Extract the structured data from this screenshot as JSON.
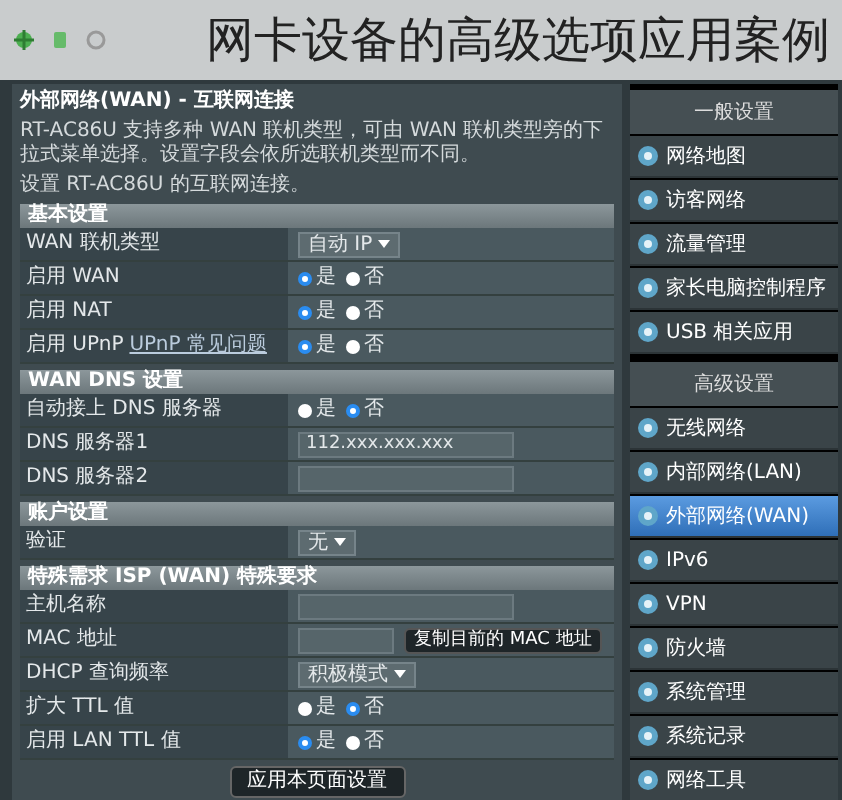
{
  "caption": "网卡设备的高级选项应用案例",
  "content": {
    "title": "外部网络(WAN) - 互联网连接",
    "description": "RT-AC86U 支持多种 WAN 联机类型，可由 WAN 联机类型旁的下拉式菜单选择。设置字段会依所选联机类型而不同。",
    "intro": "设置 RT-AC86U 的互联网连接。",
    "sections": [
      {
        "title": "基本设置",
        "rows": [
          {
            "label": "WAN 联机类型",
            "kind": "select",
            "value": "自动 IP"
          },
          {
            "label": "启用 WAN",
            "kind": "radio",
            "options": [
              {
                "label": "是",
                "selected": true
              },
              {
                "label": "否",
                "selected": false
              }
            ]
          },
          {
            "label": "启用 NAT",
            "kind": "radio",
            "options": [
              {
                "label": "是",
                "selected": true
              },
              {
                "label": "否",
                "selected": false
              }
            ]
          },
          {
            "label": "启用 UPnP",
            "link": "UPnP 常见问题",
            "kind": "radio",
            "options": [
              {
                "label": "是",
                "selected": true
              },
              {
                "label": "否",
                "selected": false
              }
            ]
          }
        ]
      },
      {
        "title": "WAN DNS 设置",
        "rows": [
          {
            "label": "自动接上 DNS 服务器",
            "kind": "radio",
            "options": [
              {
                "label": "是",
                "selected": false
              },
              {
                "label": "否",
                "selected": true
              }
            ]
          },
          {
            "label": "DNS 服务器1",
            "kind": "input",
            "value": "112.xxx.xxx.xxx"
          },
          {
            "label": "DNS 服务器2",
            "kind": "input"
          }
        ]
      },
      {
        "title": "账户设置",
        "rows": [
          {
            "label": "验证",
            "kind": "select",
            "value": "无"
          }
        ]
      },
      {
        "title": "特殊需求 ISP (WAN) 特殊要求",
        "rows": [
          {
            "label": "主机名称",
            "kind": "input"
          },
          {
            "label": "MAC 地址",
            "kind": "input",
            "button": "复制目前的 MAC 地址"
          },
          {
            "label": "DHCP 查询频率",
            "kind": "select",
            "value": "积极模式"
          },
          {
            "label": "扩大 TTL 值",
            "kind": "radio",
            "options": [
              {
                "label": "是",
                "selected": false
              },
              {
                "label": "否",
                "selected": true
              }
            ]
          },
          {
            "label": "启用 LAN TTL 值",
            "kind": "radio",
            "options": [
              {
                "label": "是",
                "selected": true
              },
              {
                "label": "否",
                "selected": false
              }
            ]
          }
        ]
      }
    ],
    "apply_button": "应用本页面设置"
  },
  "sidebar": {
    "items": [
      {
        "label": "一般设置",
        "kind": "header"
      },
      {
        "label": "网络地图",
        "kind": "item",
        "selected": false
      },
      {
        "label": "访客网络",
        "kind": "item",
        "selected": false
      },
      {
        "label": "流量管理",
        "kind": "item",
        "selected": false
      },
      {
        "label": "家长电脑控制程序",
        "kind": "item",
        "selected": false
      },
      {
        "label": "USB 相关应用",
        "kind": "item",
        "selected": false
      },
      {
        "label": "高级设置",
        "kind": "header"
      },
      {
        "label": "无线网络",
        "kind": "item",
        "selected": false
      },
      {
        "label": "内部网络(LAN)",
        "kind": "item",
        "selected": false
      },
      {
        "label": "外部网络(WAN)",
        "kind": "item",
        "selected": true
      },
      {
        "label": "IPv6",
        "kind": "item",
        "selected": false
      },
      {
        "label": "VPN",
        "kind": "item",
        "selected": false
      },
      {
        "label": "防火墙",
        "kind": "item",
        "selected": false
      },
      {
        "label": "系统管理",
        "kind": "item",
        "selected": false
      },
      {
        "label": "系统记录",
        "kind": "item",
        "selected": false
      },
      {
        "label": "网络工具",
        "kind": "item",
        "selected": false
      }
    ]
  }
}
